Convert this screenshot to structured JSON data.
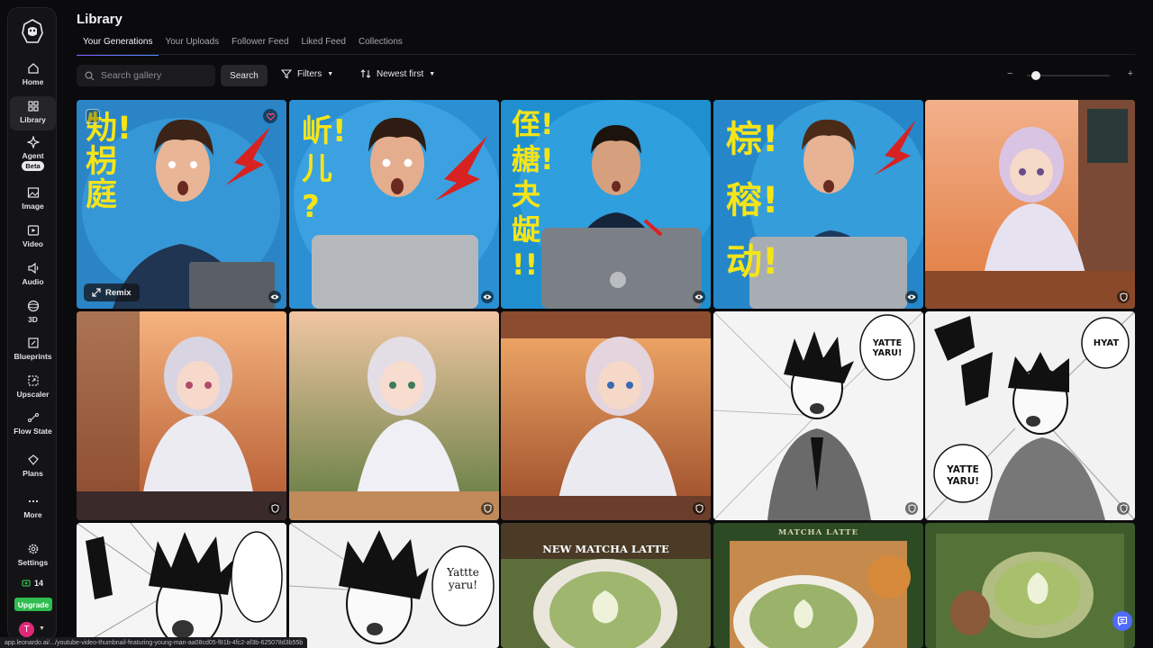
{
  "sidebar": {
    "items": [
      {
        "label": "Home",
        "icon": "home-icon"
      },
      {
        "label": "Library",
        "icon": "library-icon",
        "active": true
      },
      {
        "label": "Agent",
        "icon": "agent-icon",
        "badge": "Beta"
      },
      {
        "label": "Image",
        "icon": "image-icon"
      },
      {
        "label": "Video",
        "icon": "video-icon"
      },
      {
        "label": "Audio",
        "icon": "audio-icon"
      },
      {
        "label": "3D",
        "icon": "cube-icon"
      },
      {
        "label": "Blueprints",
        "icon": "blueprint-icon"
      },
      {
        "label": "Upscaler",
        "icon": "upscaler-icon"
      },
      {
        "label": "Flow State",
        "icon": "flow-icon"
      },
      {
        "label": "Plans",
        "icon": "plans-icon"
      },
      {
        "label": "More",
        "icon": "more-icon"
      }
    ],
    "settings_label": "Settings",
    "credits": "14",
    "upgrade_label": "Upgrade",
    "avatar_initial": "T"
  },
  "header": {
    "title": "Library",
    "tabs": [
      {
        "label": "Your Generations",
        "active": true
      },
      {
        "label": "Your Uploads"
      },
      {
        "label": "Follower Feed"
      },
      {
        "label": "Liked Feed"
      },
      {
        "label": "Collections"
      }
    ]
  },
  "toolbar": {
    "search_placeholder": "Search gallery",
    "search_label": "Search",
    "filters_label": "Filters",
    "sort_label": "Newest first",
    "zoom_minus": "−",
    "zoom_plus": "+",
    "zoom_level": 0.05
  },
  "gallery": {
    "remix_label": "Remix",
    "tiles": [
      {
        "subject": "young man surprised, laptop, red arrow",
        "text": [
          "劮!",
          "枴",
          "庭"
        ]
      },
      {
        "subject": "young man pointing, laptop, red arrow",
        "text": [
          "岓!",
          "儿",
          "?"
        ]
      },
      {
        "subject": "young man with laptop",
        "text": [
          "侄!",
          "赯!",
          "夬",
          "龊",
          "!!"
        ]
      },
      {
        "subject": "young man surprised, red arrow",
        "text": [
          "棕!",
          "穃!",
          "动!"
        ]
      },
      {
        "subject": "anime girl by window"
      },
      {
        "subject": "anime girl sunset window"
      },
      {
        "subject": "anime girl pointing"
      },
      {
        "subject": "anime girl at desk"
      },
      {
        "subject": "manga man in suit",
        "text": [
          "YATTE YARU!"
        ]
      },
      {
        "subject": "manga man shocked",
        "text": [
          "HYAT",
          "YATTE YARU!"
        ]
      },
      {
        "subject": "manga boy shouting"
      },
      {
        "subject": "manga boy",
        "text": [
          "Yattte yaru!"
        ]
      },
      {
        "subject": "matcha latte",
        "text": [
          "NEW MATCHA LATTE"
        ]
      },
      {
        "subject": "matcha latte",
        "text": [
          "MATCHA LATTE"
        ]
      },
      {
        "subject": "matcha latte frame"
      }
    ]
  },
  "status_url": "app.leonardo.ai/.../youtube-video-thumbnail-featuring-young-man-aa08cd05-f81b-4fc2-af3b-625078d3b55b"
}
